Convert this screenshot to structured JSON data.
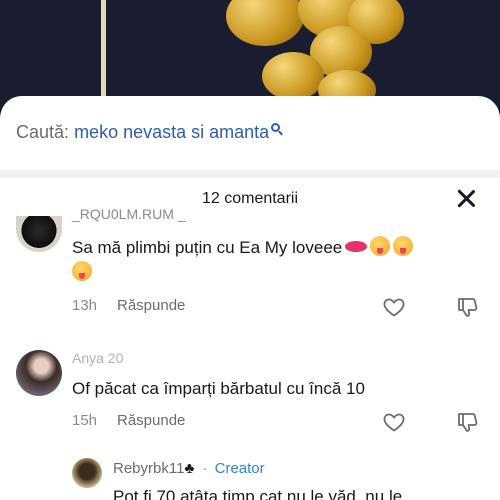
{
  "search": {
    "prefix": "Caută:",
    "query": "meko nevasta si amanta"
  },
  "comments_header": {
    "title": "12 comentarii"
  },
  "comments": [
    {
      "username": "_RQU0LM.RUM _",
      "text": "Sa mă plimbi puțin cu Ea My loveee",
      "time": "13h",
      "reply_label": "Răspunde"
    },
    {
      "username": "Anya 20",
      "text": "Of păcat ca împarți bărbatul cu încă 10",
      "time": "15h",
      "reply_label": "Răspunde"
    }
  ],
  "reply": {
    "username": "Rebyrbk11",
    "separator": "·",
    "badge": "Creator",
    "text": "Pot fi 70 atâta timp cat nu le văd, nu le"
  },
  "colors": {
    "accent_link": "#2f5bb3",
    "creator": "#2e87c8",
    "text": "#161823",
    "muted": "#8a8a8a"
  }
}
